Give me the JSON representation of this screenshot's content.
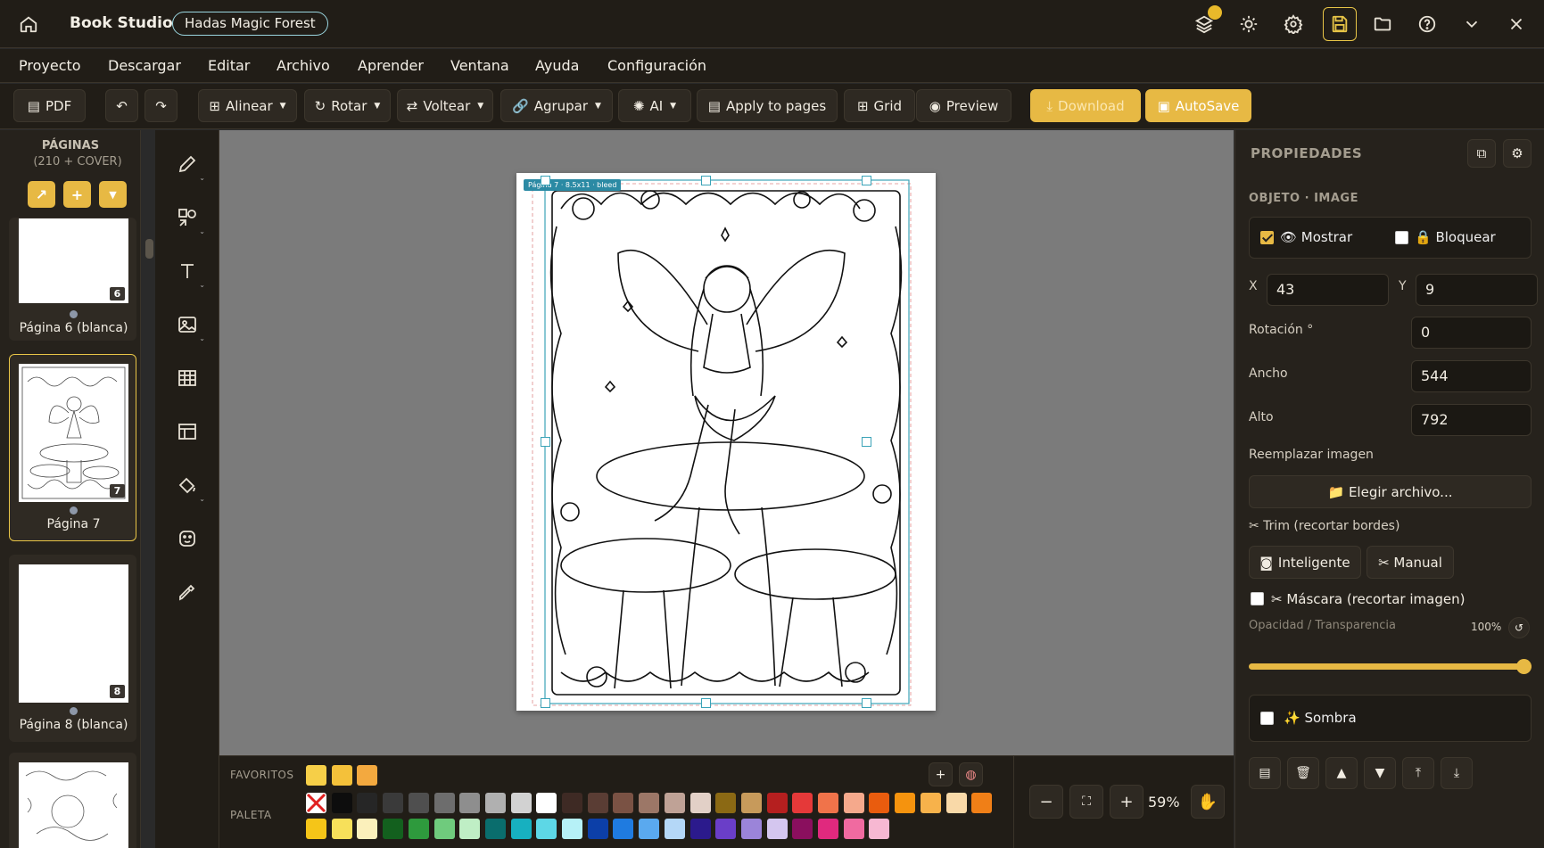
{
  "titlebar": {
    "app_name": "Book Studio",
    "project_name": "Hadas Magic Forest",
    "icons": [
      "home-icon",
      "layers-icon",
      "sun-icon",
      "gear-icon",
      "save-icon",
      "folder-icon",
      "help-icon",
      "chevron-down-icon",
      "close-icon"
    ]
  },
  "menu": [
    "Proyecto",
    "Descargar",
    "Editar",
    "Archivo",
    "Aprender",
    "Ventana",
    "Ayuda",
    "Configuración"
  ],
  "toolbar": {
    "pdf": "PDF",
    "undo": "↶",
    "redo": "↷",
    "align": "Alinear",
    "rotate": "Rotar",
    "flip": "Voltear",
    "group": "Agrupar",
    "ai": "AI",
    "apply_pages": "Apply to pages",
    "grid": "Grid",
    "preview": "Preview",
    "download": "Download",
    "autosave": "AutoSave"
  },
  "pages_panel": {
    "title": "PÁGINAS",
    "count": "(210 + COVER)",
    "pages": [
      {
        "number": "6",
        "label": "Página 6 (blanca)",
        "selected": false
      },
      {
        "number": "7",
        "label": "Página 7",
        "selected": true
      },
      {
        "number": "8",
        "label": "Página 8 (blanca)",
        "selected": false
      }
    ]
  },
  "canvas": {
    "page_tag": "Página 7 · 8.5x11 · bleed"
  },
  "palette": {
    "favorites_label": "FAVORITOS",
    "palette_label": "PALETA",
    "favorites": [
      "#f6cf48",
      "#f4c13a",
      "#f3a93f"
    ],
    "row1": [
      "none",
      "#0d0d0d",
      "#262626",
      "#3a3a3a",
      "#4f4f4f",
      "#6d6d6d",
      "#8e8e8e",
      "#b0b0b0",
      "#d2d2d2",
      "#ffffff",
      "#3e2a24",
      "#5a3d34",
      "#7a5244",
      "#9c7767",
      "#bfa296",
      "#e2d0c7",
      "#8b6914",
      "#c79a5b",
      "#b51f1f",
      "#e53939",
      "#f0734a",
      "#f5a98c",
      "#e95c0e",
      "#f5930e",
      "#f7b24b",
      "#f9d9a8",
      "#f07f17"
    ],
    "row2": [
      "#f5c518",
      "#f7e05a",
      "#fbf0bb",
      "#13601e",
      "#2e9a3d",
      "#6fcb7d",
      "#bfeec5",
      "#0a6d6d",
      "#17b0c0",
      "#5dd7e6",
      "#b6f1f7",
      "#0c3fa8",
      "#1f7be0",
      "#5aa9ef",
      "#b4d7f7",
      "#2b1a8c",
      "#6a3ec8",
      "#9b84d9",
      "#d4c6ef",
      "#8a0f5e",
      "#e0297e",
      "#f06aa0",
      "#f7b8d2"
    ],
    "zoom": "59%"
  },
  "properties": {
    "title": "PROPIEDADES",
    "object_label": "OBJETO · IMAGE",
    "show_label": "👁 Mostrar",
    "show_checked": true,
    "lock_label": "🔒 Bloquear",
    "lock_checked": false,
    "x_label": "X",
    "x_value": "43",
    "y_label": "Y",
    "y_value": "9",
    "rotation_label": "Rotación °",
    "rotation_value": "0",
    "width_label": "Ancho",
    "width_value": "544",
    "height_label": "Alto",
    "height_value": "792",
    "replace_label": "Reemplazar imagen",
    "choose_file": "📁 Elegir archivo...",
    "trim_label": "✂ Trim (recortar bordes)",
    "smart": "Inteligente",
    "manual": "✂ Manual",
    "mask_label": "✂ Máscara (recortar imagen)",
    "opacity_label": "Opacidad / Transparencia",
    "opacity_value": "100%",
    "opacity_level": 1.0,
    "shadow_label": "✨ Sombra"
  }
}
